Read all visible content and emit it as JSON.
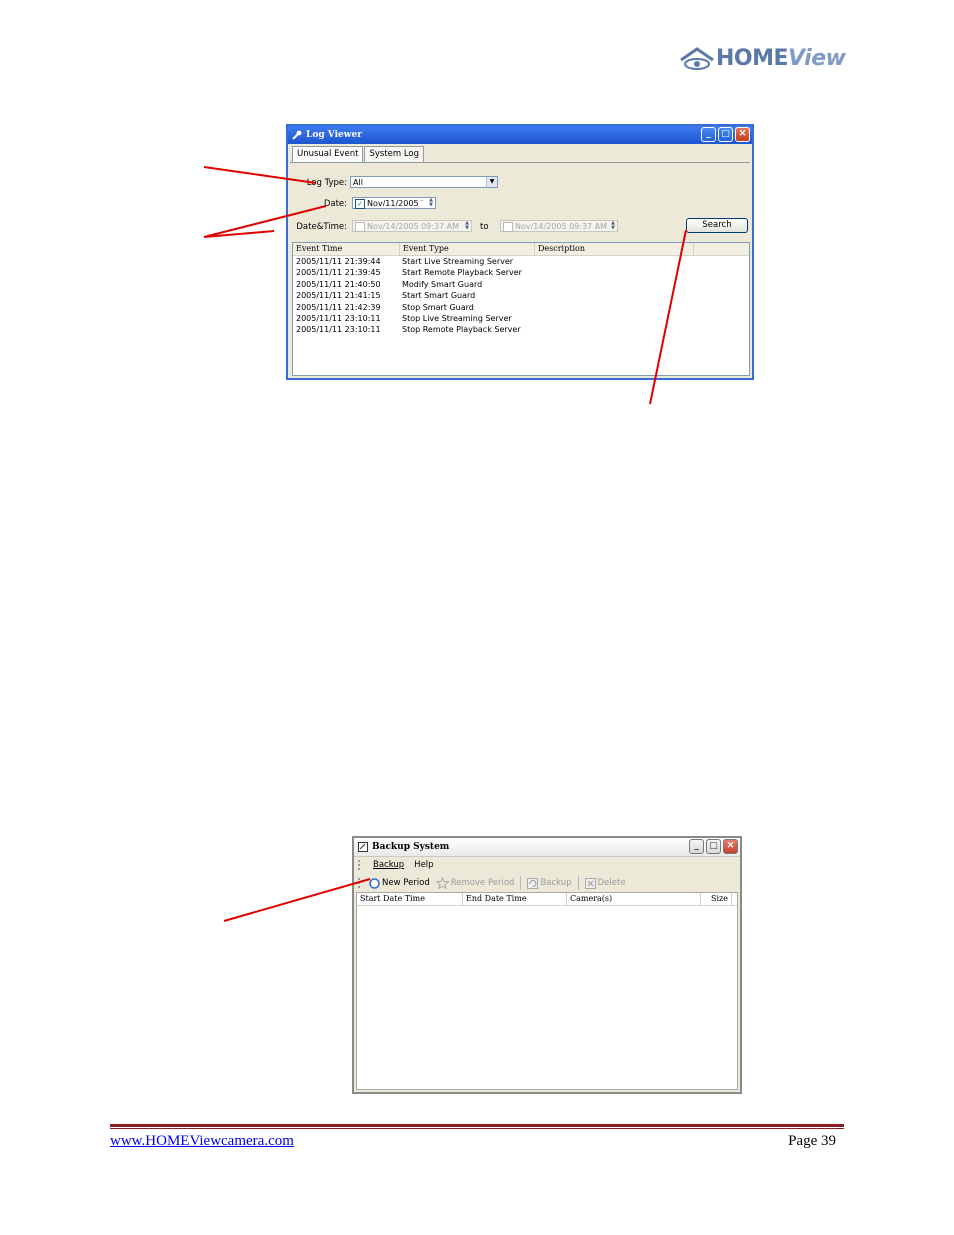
{
  "brand": {
    "name_bold": "HOME",
    "name_italic": "View"
  },
  "log_viewer": {
    "title": "Log Viewer",
    "tabs": [
      "Unusual Event",
      "System Log"
    ],
    "log_type_label": "Log Type:",
    "log_type_value": "All",
    "date_label": "Date:",
    "date_value": "Nov/11/2005",
    "datetime_label": "Date&Time:",
    "datetime_from": "Nov/14/2005 09:37 AM",
    "to_label": "to",
    "datetime_to": "Nov/14/2005 09:37 AM",
    "search_label": "Search",
    "columns": [
      "Event Time",
      "Event Type",
      "Description"
    ],
    "rows": [
      {
        "time": "2005/11/11 21:39:44",
        "type": "Start Live Streaming Server"
      },
      {
        "time": "2005/11/11 21:39:45",
        "type": "Start Remote Playback Server"
      },
      {
        "time": "2005/11/11 21:40:50",
        "type": "Modify Smart Guard"
      },
      {
        "time": "2005/11/11 21:41:15",
        "type": "Start Smart Guard"
      },
      {
        "time": "2005/11/11 21:42:39",
        "type": "Stop Smart Guard"
      },
      {
        "time": "2005/11/11 23:10:11",
        "type": "Stop Live Streaming Server"
      },
      {
        "time": "2005/11/11 23:10:11",
        "type": "Stop Remote Playback Server"
      }
    ]
  },
  "backup_system": {
    "title": "Backup System",
    "menu": [
      "Backup",
      "Help"
    ],
    "toolbar": {
      "new_period": "New Period",
      "remove_period": "Remove Period",
      "backup": "Backup",
      "delete": "Delete"
    },
    "columns": [
      "Start Date Time",
      "End Date Time",
      "Camera(s)",
      "Size"
    ]
  },
  "footer": {
    "link": "www.HOMEViewcamera.com",
    "page": "Page 39"
  },
  "colors": {
    "annotation_arrow": "#e00000",
    "footer_rule": "#8b1e24",
    "xp_blue": "#1e55d0"
  }
}
